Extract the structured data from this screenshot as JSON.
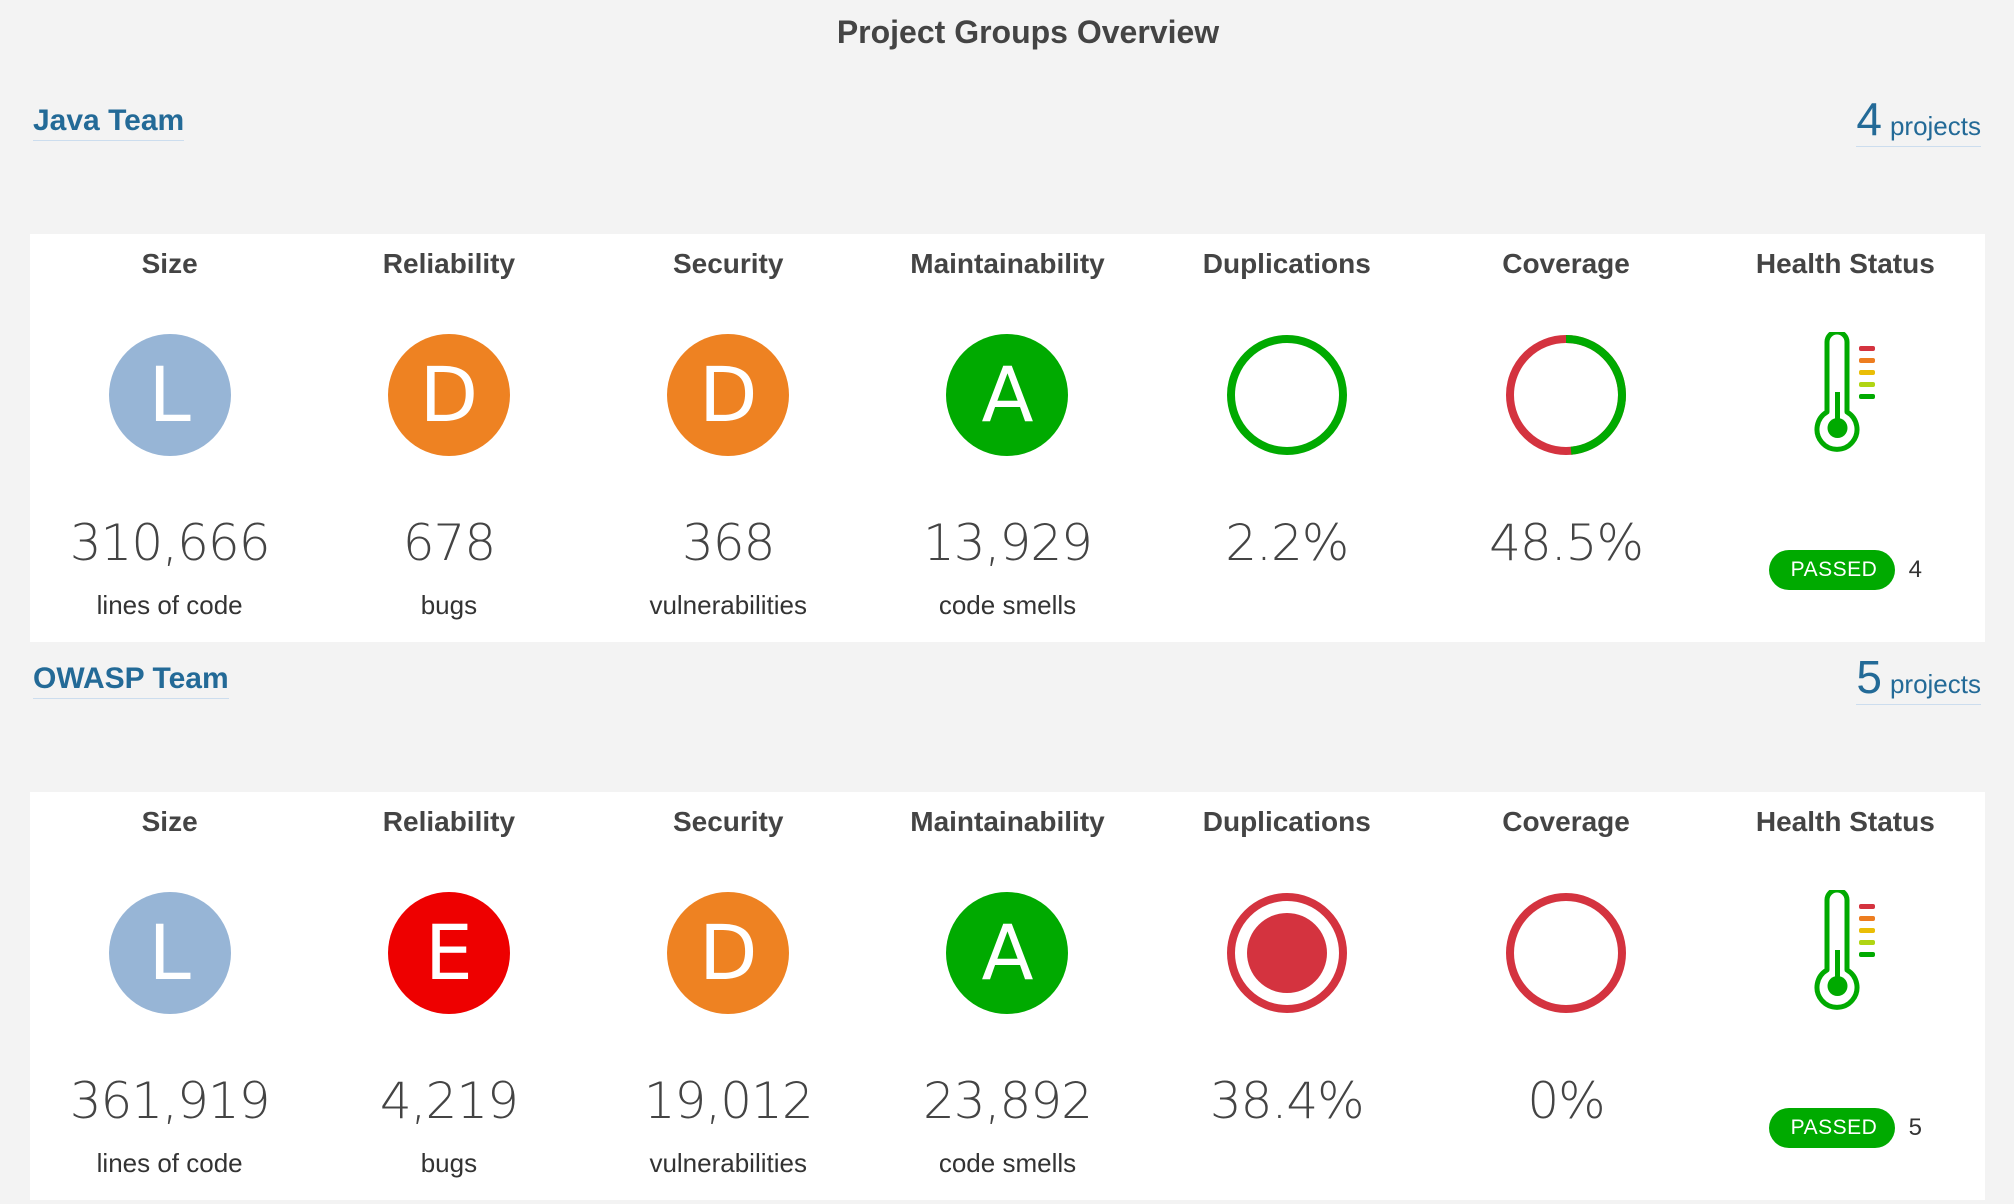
{
  "page_title": "Project Groups Overview",
  "colors": {
    "link": "#236a97",
    "rating_L": "#97b5d6",
    "rating_D": "#ee8222",
    "rating_E": "#ee0000",
    "rating_A": "#00aa00",
    "ring_green": "#00aa00",
    "ring_red": "#d4333f",
    "passed": "#00aa00"
  },
  "column_titles": [
    "Size",
    "Reliability",
    "Security",
    "Maintainability",
    "Duplications",
    "Coverage",
    "Health Status"
  ],
  "groups": [
    {
      "name": "Java Team",
      "project_count": "4",
      "project_label": "projects",
      "size": {
        "rating": "L",
        "value": "310,666",
        "unit": "lines of code"
      },
      "reliability": {
        "rating": "D",
        "value": "678",
        "unit": "bugs"
      },
      "security": {
        "rating": "D",
        "value": "368",
        "unit": "vulnerabilities"
      },
      "maintainability": {
        "rating": "A",
        "value": "13,929",
        "unit": "code smells"
      },
      "duplications": {
        "value": "2.2%",
        "percent": 2.2,
        "icon": "duplications-green-ring-icon"
      },
      "coverage": {
        "value": "48.5%",
        "percent": 48.5,
        "icon": "coverage-donut-icon"
      },
      "health": {
        "status": "PASSED",
        "count": "4",
        "icon": "thermometer-icon"
      }
    },
    {
      "name": "OWASP Team",
      "project_count": "5",
      "project_label": "projects",
      "size": {
        "rating": "L",
        "value": "361,919",
        "unit": "lines of code"
      },
      "reliability": {
        "rating": "E",
        "value": "4,219",
        "unit": "bugs"
      },
      "security": {
        "rating": "D",
        "value": "19,012",
        "unit": "vulnerabilities"
      },
      "maintainability": {
        "rating": "A",
        "value": "23,892",
        "unit": "code smells"
      },
      "duplications": {
        "value": "38.4%",
        "percent": 38.4,
        "icon": "duplications-red-bullseye-icon"
      },
      "coverage": {
        "value": "0%",
        "percent": 0,
        "icon": "coverage-donut-icon"
      },
      "health": {
        "status": "PASSED",
        "count": "5",
        "icon": "thermometer-icon"
      }
    }
  ]
}
